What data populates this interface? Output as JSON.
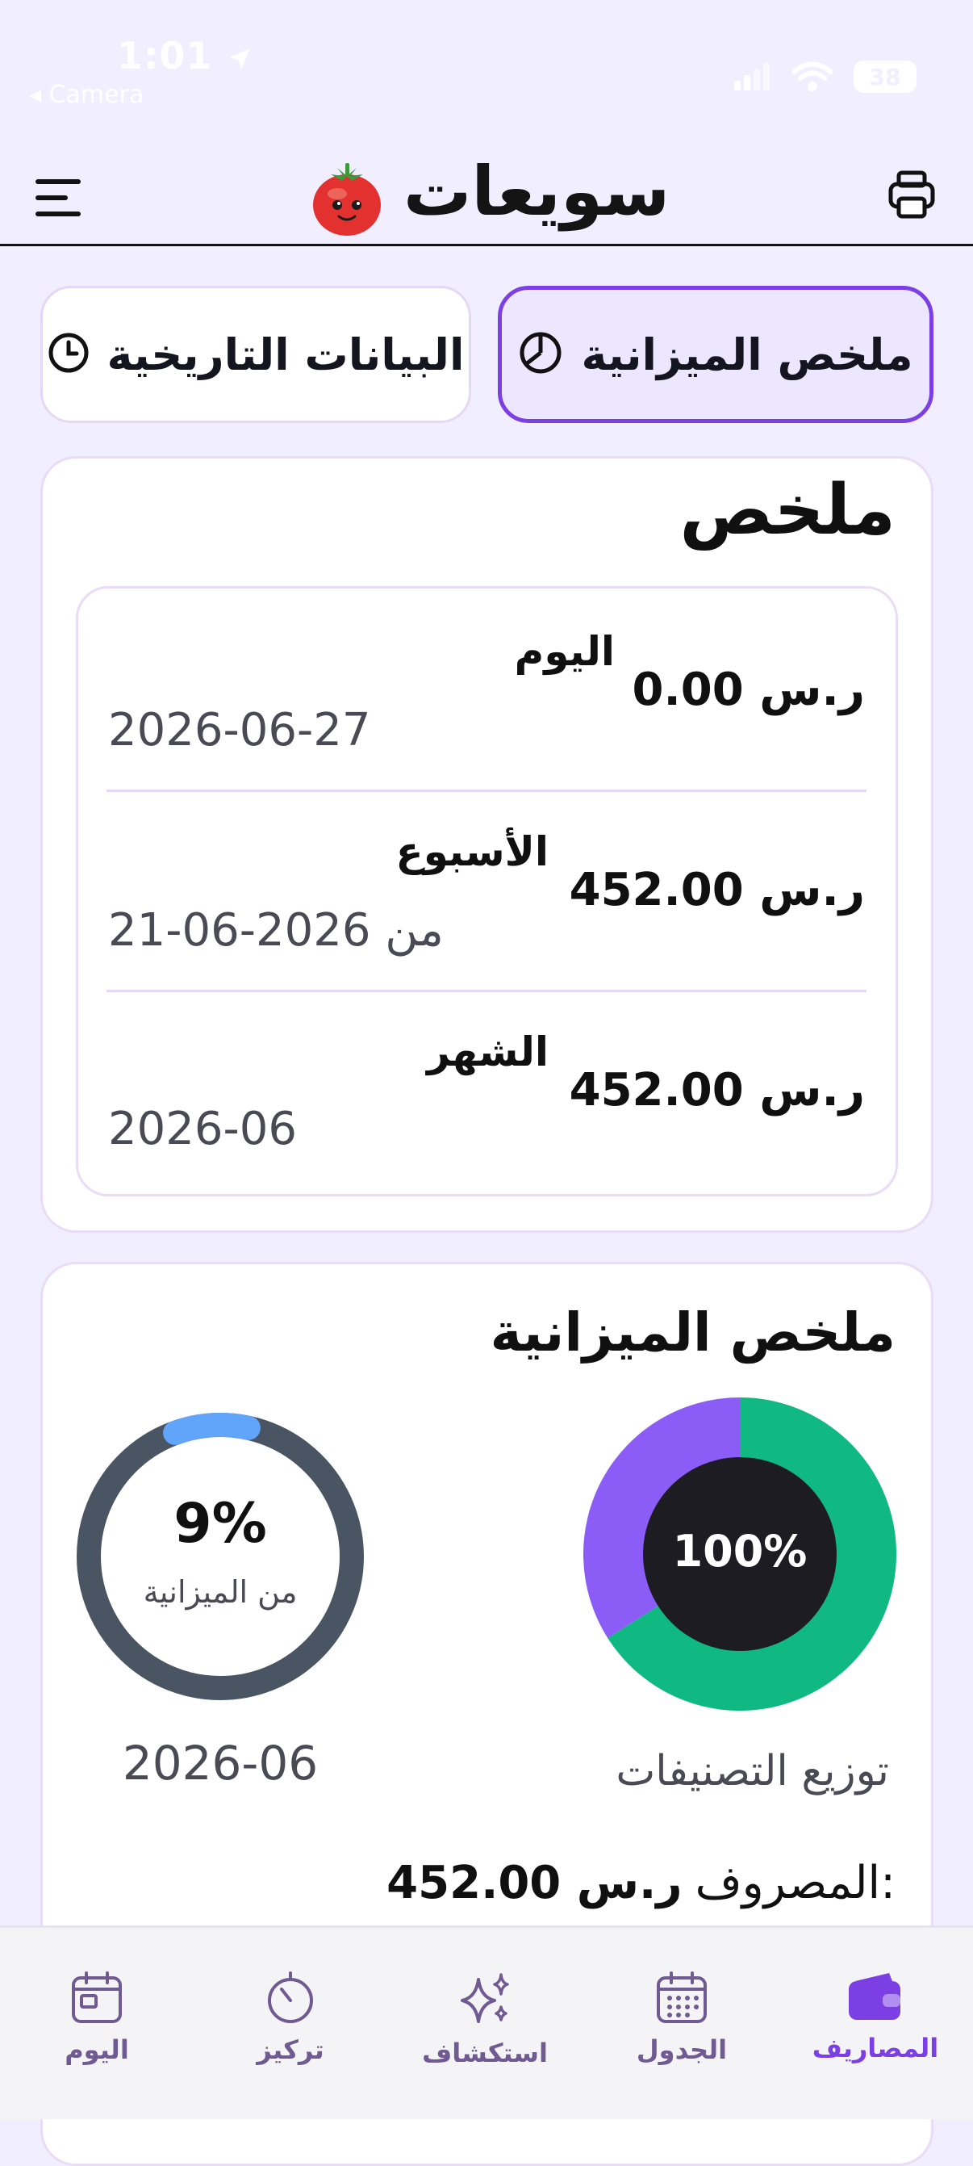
{
  "status_bar": {
    "time": "1:01",
    "back_app": "◂ Camera",
    "battery": "38"
  },
  "header": {
    "title": "سويعات",
    "menu_icon": "hamburger-menu-icon",
    "print_icon": "printer-icon",
    "logo_icon": "tomato-logo-icon"
  },
  "tabs": [
    {
      "label": "ملخص الميزانية",
      "icon": "pie-chart-icon",
      "active": true
    },
    {
      "label": "البيانات التاريخية",
      "icon": "clock-icon",
      "active": false
    }
  ],
  "summary": {
    "title": "ملخص",
    "rows": [
      {
        "label": "اليوم",
        "amount": "0.00 ر.س",
        "date": "2026-06-27"
      },
      {
        "label": "الأسبوع",
        "amount": "452.00 ر.س",
        "date": "من 2026-06-21"
      },
      {
        "label": "الشهر",
        "amount": "452.00 ر.س",
        "date": "2026-06"
      }
    ]
  },
  "budget": {
    "title": "ملخص الميزانية",
    "ring": {
      "percent_label": "9%",
      "caption": "من الميزانية",
      "month": "2026-06",
      "fraction": 0.09,
      "track_color": "#4a5563",
      "fill_color": "#60a5fa"
    },
    "category_chart": {
      "center_label": "100%",
      "caption": "توزيع التصنيفات",
      "slices": [
        {
          "fraction": 0.66,
          "color": "#10b981"
        },
        {
          "fraction": 0.34,
          "color": "#8b5cf6"
        }
      ]
    },
    "spent_label": "المصروف:",
    "spent_value": "452.00 ر.س"
  },
  "nav": [
    {
      "label": "المصاريف",
      "icon": "wallet-icon",
      "active": true
    },
    {
      "label": "الجدول",
      "icon": "calendar-grid-icon",
      "active": false
    },
    {
      "label": "استكشاف",
      "icon": "sparkles-icon",
      "active": false
    },
    {
      "label": "تركيز",
      "icon": "timer-icon",
      "active": false
    },
    {
      "label": "اليوم",
      "icon": "calendar-today-icon",
      "active": false
    }
  ],
  "colors": {
    "accent": "#7b3fe4",
    "background": "#f1efff"
  }
}
